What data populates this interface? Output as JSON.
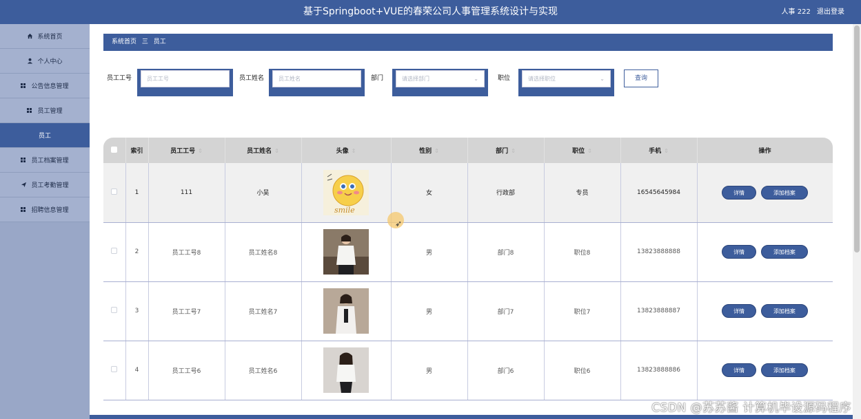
{
  "header": {
    "title": "基于Springboot+VUE的春荣公司人事管理系统设计与实现",
    "user_label": "人事 222",
    "logout_label": "退出登录"
  },
  "sidebar": {
    "items": [
      {
        "label": "系统首页",
        "icon": "home-icon"
      },
      {
        "label": "个人中心",
        "icon": "user-icon"
      },
      {
        "label": "公告信息管理",
        "icon": "grid-icon"
      },
      {
        "label": "员工管理",
        "icon": "grid-icon"
      },
      {
        "label": "员工",
        "icon": ""
      },
      {
        "label": "员工档案管理",
        "icon": "grid-icon"
      },
      {
        "label": "员工考勤管理",
        "icon": "send-icon"
      },
      {
        "label": "招聘信息管理",
        "icon": "grid-icon"
      }
    ]
  },
  "breadcrumb": {
    "home": "系统首页",
    "separator": "三",
    "current": "员工"
  },
  "search": {
    "employee_no_label": "员工工号",
    "employee_no_placeholder": "员工工号",
    "employee_name_label": "员工姓名",
    "employee_name_placeholder": "员工姓名",
    "department_label": "部门",
    "department_placeholder": "请选择部门",
    "position_label": "职位",
    "position_placeholder": "请选择职位",
    "query_label": "查询"
  },
  "table": {
    "headers": {
      "index": "索引",
      "employee_no": "员工工号",
      "employee_name": "员工姓名",
      "avatar": "头像",
      "gender": "性别",
      "department": "部门",
      "position": "职位",
      "phone": "手机",
      "actions": "操作"
    },
    "rows": [
      {
        "index": "1",
        "employee_no": "111",
        "employee_name": "小吴",
        "avatar": "smile-sticker",
        "gender": "女",
        "department": "行政部",
        "position": "专员",
        "phone": "16545645984"
      },
      {
        "index": "2",
        "employee_no": "员工工号8",
        "employee_name": "员工姓名8",
        "avatar": "photo-woman-white-shirt",
        "gender": "男",
        "department": "部门8",
        "position": "职位8",
        "phone": "13823888888"
      },
      {
        "index": "3",
        "employee_no": "员工工号7",
        "employee_name": "员工姓名7",
        "avatar": "photo-woman-white-shirt",
        "gender": "男",
        "department": "部门7",
        "position": "职位7",
        "phone": "13823888887"
      },
      {
        "index": "4",
        "employee_no": "员工工号6",
        "employee_name": "员工姓名6",
        "avatar": "photo-woman-white-shirt",
        "gender": "男",
        "department": "部门6",
        "position": "职位6",
        "phone": "13823888886"
      }
    ],
    "detail_label": "详情",
    "add_archive_label": "添加档案"
  },
  "watermark": "CSDN @苏苏酱 计算机毕设源码程序",
  "colors": {
    "primary": "#3d5d9c",
    "sidebar": "#99a7c7",
    "header_row": "#d4d4d4"
  }
}
